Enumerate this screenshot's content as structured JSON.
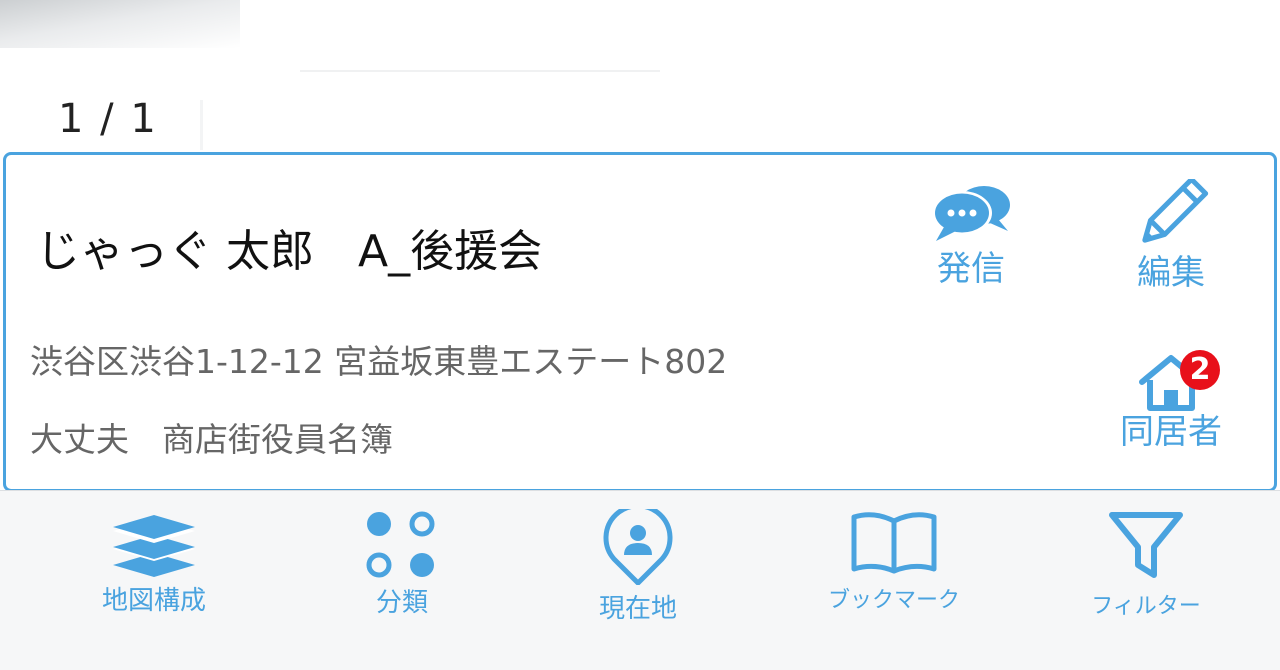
{
  "pager": {
    "text": "1 / 1"
  },
  "card": {
    "title": "じゃっぐ 太郎　A_後援会",
    "address": "渋谷区渋谷1-12-12 宮益坂東豊エステート802",
    "group": "大丈夫　商店街役員名簿",
    "actions": {
      "send": {
        "label": "発信",
        "icon": "chat-bubbles-icon"
      },
      "edit": {
        "label": "編集",
        "icon": "pencil-icon"
      },
      "household": {
        "label": "同居者",
        "icon": "house-icon",
        "badge": "2"
      }
    }
  },
  "tabs": [
    {
      "label": "地図構成",
      "icon": "layers-icon"
    },
    {
      "label": "分類",
      "icon": "category-dots-icon"
    },
    {
      "label": "現在地",
      "icon": "location-pin-icon"
    },
    {
      "label": "ブックマーク",
      "icon": "book-icon"
    },
    {
      "label": "フィルター",
      "icon": "filter-icon"
    }
  ],
  "colors": {
    "accent": "#4aa3df",
    "badge": "#e8101a",
    "title_text": "#111111",
    "secondary_text": "#666666"
  }
}
